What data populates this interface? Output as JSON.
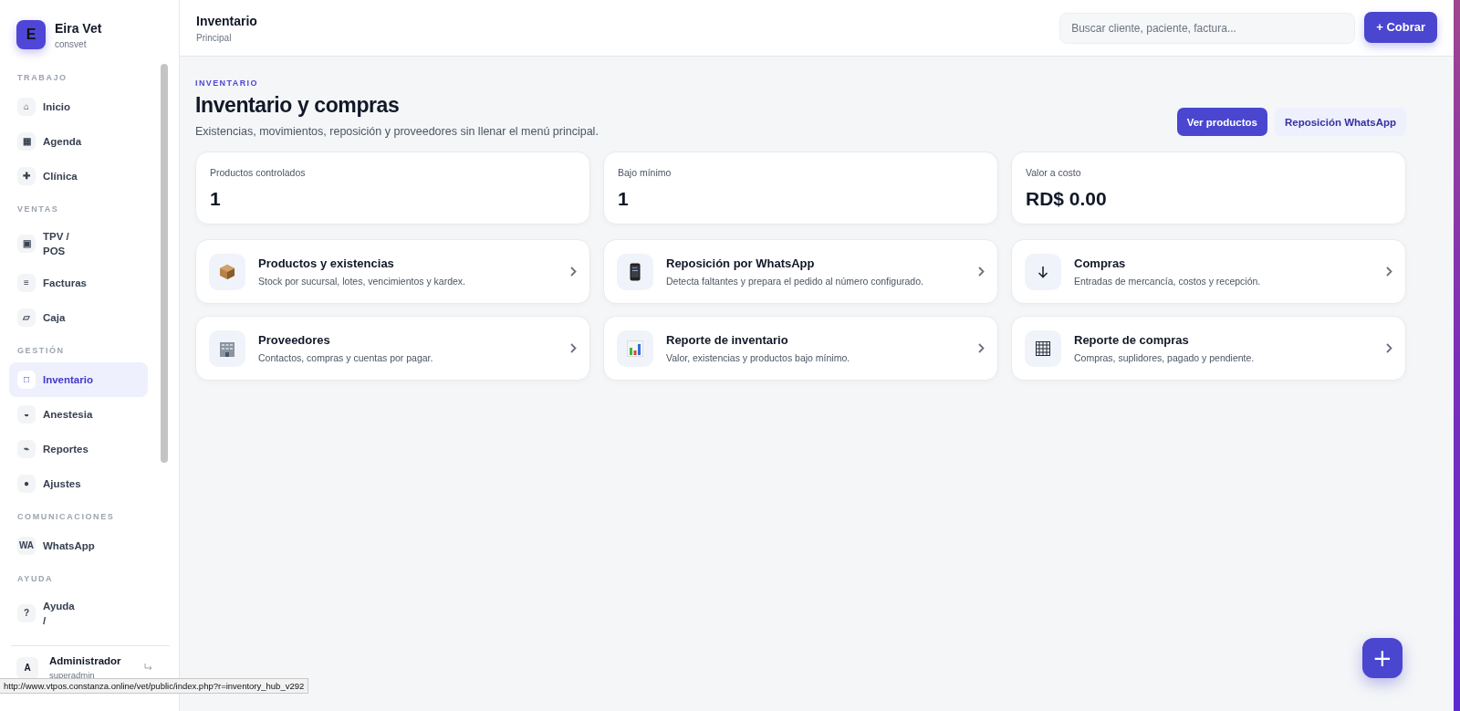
{
  "sidebar": {
    "brand": {
      "logo": "E",
      "name": "Eira Vet",
      "subtitle": "consvet"
    },
    "sections": [
      {
        "title": "TRABAJO",
        "items": [
          {
            "icon": "⌂",
            "label": "Inicio",
            "selected": false
          },
          {
            "icon": "▦",
            "label": "Agenda",
            "selected": false
          },
          {
            "icon": "✚",
            "label": "Clínica",
            "selected": false
          }
        ]
      },
      {
        "title": "VENTAS",
        "items": [
          {
            "icon": "▣",
            "label": "TPV / POS",
            "selected": false
          },
          {
            "icon": "≡",
            "label": "Facturas",
            "selected": false
          },
          {
            "icon": "▱",
            "label": "Caja",
            "selected": false
          }
        ]
      },
      {
        "title": "GESTIÓN",
        "items": [
          {
            "icon": "□",
            "label": "Inventario",
            "selected": true
          },
          {
            "icon": "◒",
            "label": "Anestesia",
            "selected": false
          },
          {
            "icon": "⌁",
            "label": "Reportes",
            "selected": false
          },
          {
            "icon": "●",
            "label": "Ajustes",
            "selected": false
          }
        ]
      },
      {
        "title": "COMUNICACIONES",
        "items": [
          {
            "icon": "WA",
            "label": "WhatsApp",
            "selected": false
          }
        ]
      },
      {
        "title": "AYUDA",
        "items": [
          {
            "icon": "?",
            "label": "Ayuda /",
            "selected": false
          }
        ]
      }
    ],
    "user": {
      "avatar": "A",
      "name": "Administrador",
      "role": "superadmin"
    }
  },
  "topbar": {
    "title": "Inventario",
    "breadcrumb": "Principal",
    "search": {
      "placeholder": "Buscar cliente, paciente, factura..."
    },
    "action": "+ Cobrar"
  },
  "page": {
    "eyebrow": "INVENTARIO",
    "title": "Inventario y compras",
    "subtitle": "Existencias, movimientos, reposición y proveedores sin llenar el menú principal.",
    "buttons": [
      {
        "label": "Ver productos",
        "kind": "primary"
      },
      {
        "label": "Reposición WhatsApp",
        "kind": "soft"
      }
    ]
  },
  "stats": [
    {
      "label": "Productos controlados",
      "value": "1"
    },
    {
      "label": "Bajo mínimo",
      "value": "1"
    },
    {
      "label": "Valor a costo",
      "value": "RD$ 0.00"
    }
  ],
  "tiles": [
    {
      "kind": "box",
      "title": "Productos y existencias",
      "description": "Stock por sucursal, lotes, vencimientos y kardex."
    },
    {
      "kind": "phone",
      "title": "Reposición por WhatsApp",
      "description": "Detecta faltantes y prepara el pedido al número configurado."
    },
    {
      "kind": "arrow",
      "title": "Compras",
      "description": "Entradas de mercancía, costos y recepción."
    },
    {
      "kind": "building",
      "title": "Proveedores",
      "description": "Contactos, compras y cuentas por pagar."
    },
    {
      "kind": "chart",
      "title": "Reporte de inventario",
      "description": "Valor, existencias y productos bajo mínimo."
    },
    {
      "kind": "grid",
      "title": "Reporte de compras",
      "description": "Compras, suplidores, pagado y pendiente."
    }
  ],
  "fab": {
    "label": "+"
  },
  "status_url": "http://www.vtpos.constanza.online/vet/public/index.php?r=inventory_hub_v292"
}
